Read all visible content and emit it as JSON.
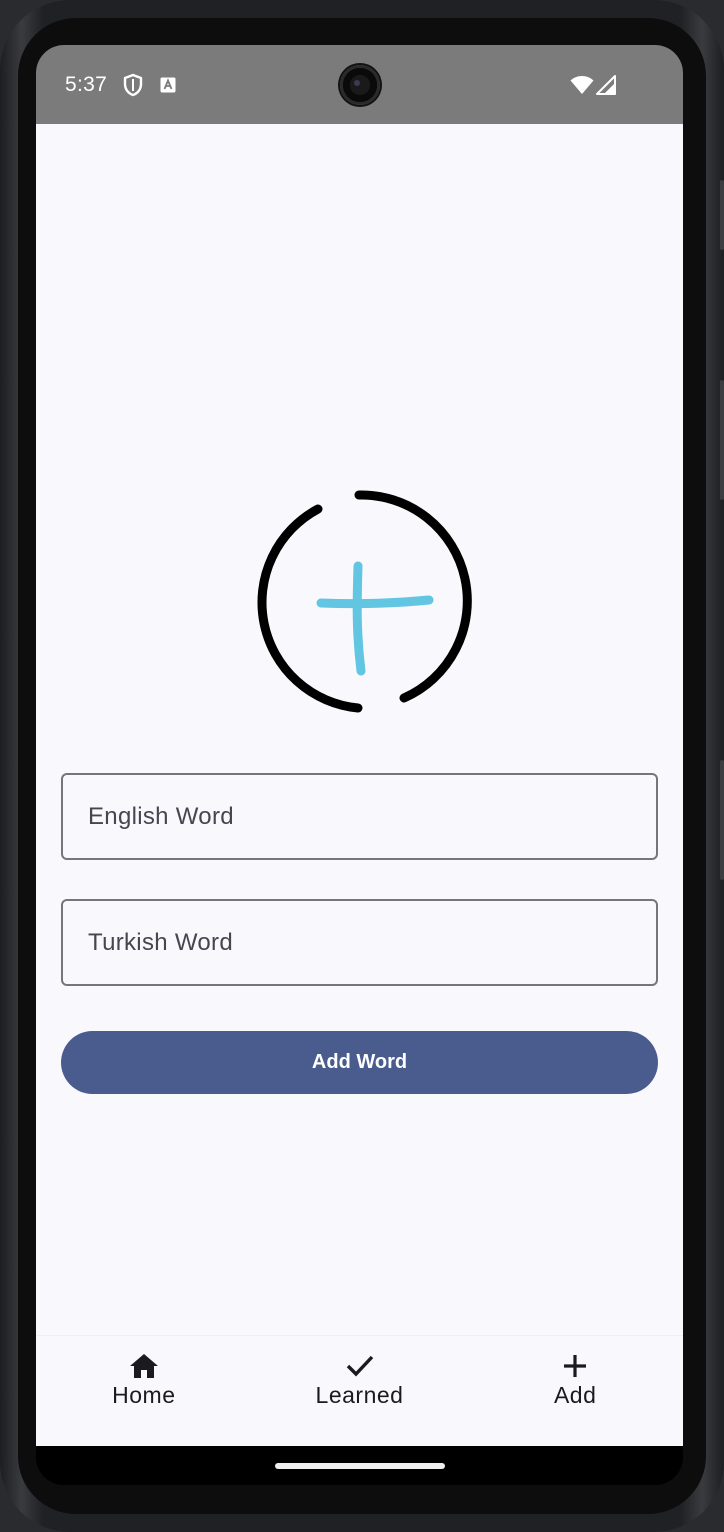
{
  "status_bar": {
    "time": "5:37",
    "icons": [
      "shield-icon",
      "a-badge-icon",
      "wifi-icon",
      "signal-icon"
    ],
    "background": "#7b7b7b"
  },
  "hero": {
    "icon": "add-circle-icon",
    "ring_color": "#000000",
    "plus_color": "#62c6e3"
  },
  "form": {
    "english_field": {
      "placeholder": "English Word",
      "value": ""
    },
    "turkish_field": {
      "placeholder": "Turkish Word",
      "value": ""
    },
    "submit_label": "Add Word",
    "submit_color": "#4a5c8e"
  },
  "bottom_nav": {
    "items": [
      {
        "label": "Home",
        "icon": "home-icon"
      },
      {
        "label": "Learned",
        "icon": "check-icon"
      },
      {
        "label": "Add",
        "icon": "plus-icon"
      }
    ]
  },
  "theme": {
    "surface": "#f9f8fd",
    "outline": "#75757c",
    "on_surface": "#1b1b1f"
  }
}
